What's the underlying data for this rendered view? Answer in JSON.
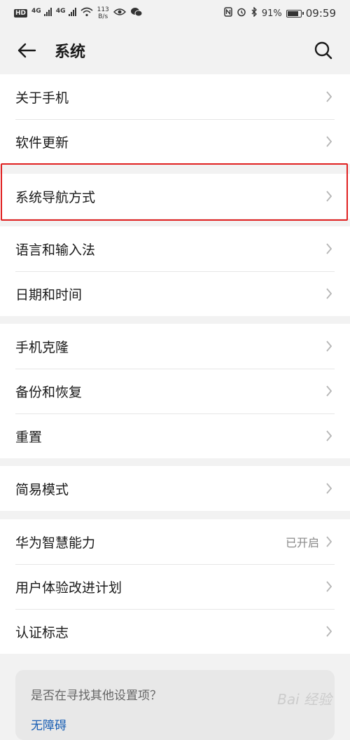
{
  "status_bar": {
    "left_badge": "HD",
    "signal1_label": "4G",
    "signal2_label": "4G",
    "net_speed_value": "113",
    "net_speed_unit": "B/s",
    "battery": "91%",
    "battery_level": 0.91,
    "time": "09:59"
  },
  "header": {
    "title": "系统"
  },
  "groups": [
    {
      "items": [
        {
          "label": "关于手机"
        },
        {
          "label": "软件更新"
        }
      ]
    },
    {
      "items": [
        {
          "label": "系统导航方式"
        }
      ]
    },
    {
      "items": [
        {
          "label": "语言和输入法"
        },
        {
          "label": "日期和时间"
        }
      ]
    },
    {
      "items": [
        {
          "label": "手机克隆"
        },
        {
          "label": "备份和恢复"
        },
        {
          "label": "重置"
        }
      ]
    },
    {
      "items": [
        {
          "label": "简易模式"
        }
      ]
    },
    {
      "items": [
        {
          "label": "华为智慧能力",
          "value": "已开启"
        },
        {
          "label": "用户体验改进计划"
        },
        {
          "label": "认证标志"
        }
      ]
    }
  ],
  "suggest": {
    "question": "是否在寻找其他设置项？",
    "link": "无障碍"
  },
  "watermark": "Bai 经验"
}
